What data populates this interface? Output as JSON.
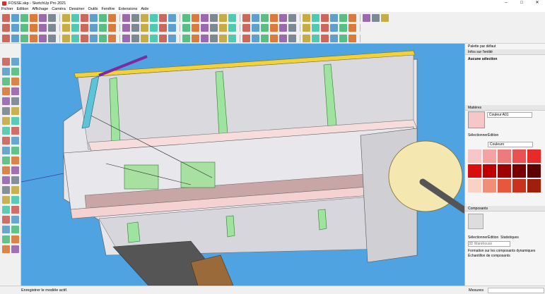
{
  "window": {
    "title": "FOSSE.skp - SketchUp Pro 2021",
    "controls": [
      "–",
      "□",
      "✕"
    ]
  },
  "menu": [
    "Fichier",
    "Edition",
    "Affichage",
    "Caméra",
    "Dessiner",
    "Outils",
    "Fenêtre",
    "Extensions",
    "Aide"
  ],
  "toolbar_icons": {
    "row1": [
      "search-icon",
      "zoom-icon",
      "rotate-icon",
      "folder-icon",
      "undo-icon",
      "redo-icon",
      "print-icon",
      "cursor-icon",
      "eraser-icon",
      "paint-icon",
      "lasso-icon",
      "move-icon",
      "sphere-icon",
      "rectangle-icon",
      "pencil-icon",
      "scale-icon",
      "ruler-icon",
      "tape-icon",
      "text-icon",
      "house-icon",
      "box-icon"
    ],
    "row2": [
      "line-icon",
      "arc-icon",
      "curve-icon",
      "wave-icon",
      "mirror-icon",
      "cube-icon",
      "shape-icon",
      "push-icon",
      "paint-bucket-icon",
      "window-icon",
      "pencil-icon",
      "trash-icon"
    ],
    "row3": [
      "line-icon",
      "circle-icon",
      "arc-icon",
      "polygon-icon",
      "freehand-icon",
      "dimension-icon",
      "protractor-icon",
      "axes-icon",
      "section-icon",
      "camera-icon",
      "walk-icon",
      "lookaround-icon"
    ]
  },
  "panel": {
    "tray_title": "Palette par défaut",
    "entity_info": {
      "header": "Infos sur l'entité",
      "selection": "Aucune sélection"
    },
    "materials": {
      "header": "Matières",
      "material_name": "Couleur A01",
      "tabs": [
        "Sélectionner",
        "Édition"
      ],
      "library": "Couleurs",
      "swatch_colors": [
        "#f7c6c6",
        "#f4a3a3",
        "#ee7b7b",
        "#e85252",
        "#e62b2b",
        "#d90f0f",
        "#c00000",
        "#9d0000",
        "#7a0000",
        "#5c0000",
        "#f9d2c6",
        "#f28e78",
        "#e6573d",
        "#c9321c",
        "#a01e0c"
      ]
    },
    "components": {
      "header": "Composants",
      "tabs": [
        "Sélectionner",
        "Édition",
        "Statistiques"
      ],
      "search_placeholder": "3D Warehouse",
      "description": "Formation sur les composants dynamiques",
      "sample": "Échantillon de composants"
    }
  },
  "status": {
    "message": "Enregistrer le modèle actif.",
    "measure_label": "Mesures",
    "measure_value": ""
  }
}
